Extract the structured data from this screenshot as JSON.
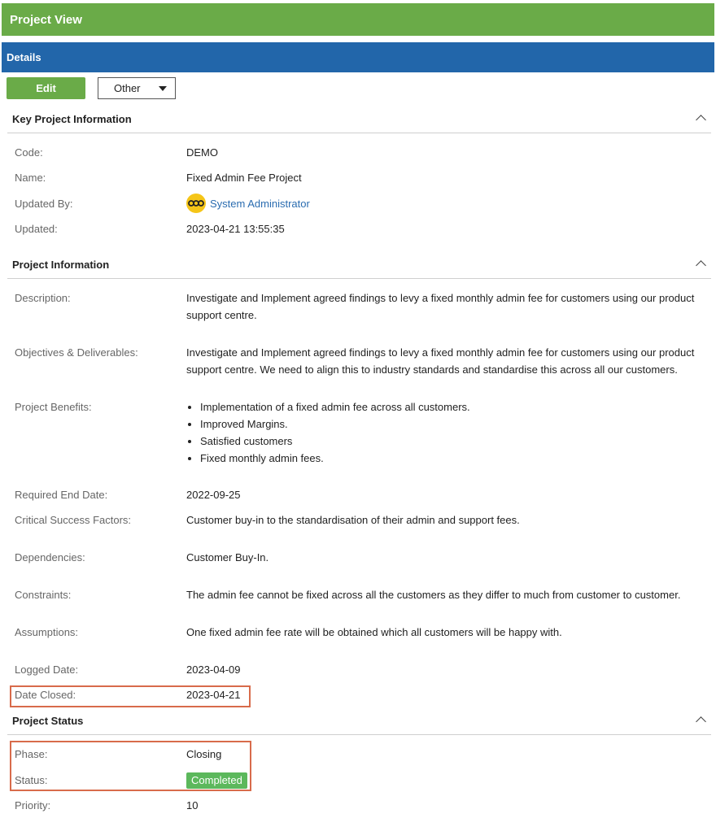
{
  "header": {
    "title": "Project View"
  },
  "details_bar": {
    "title": "Details"
  },
  "toolbar": {
    "edit_label": "Edit",
    "other_label": "Other"
  },
  "key_info": {
    "title": "Key Project Information",
    "code_label": "Code:",
    "code": "DEMO",
    "name_label": "Name:",
    "name": "Fixed Admin Fee Project",
    "updated_by_label": "Updated By:",
    "updated_by": "System Administrator",
    "updated_label": "Updated:",
    "updated": "2023-04-21 13:55:35"
  },
  "project_info": {
    "title": "Project Information",
    "description_label": "Description:",
    "description": "Investigate and Implement agreed findings to levy a fixed monthly admin fee for customers using our product support centre.",
    "objectives_label": "Objectives & Deliverables:",
    "objectives": "Investigate and Implement agreed findings to levy a fixed monthly admin fee for customers using our product support centre. We need to align this to industry standards and standardise this across all our customers.",
    "benefits_label": "Project Benefits:",
    "benefits": [
      "Implementation of a fixed admin fee across all customers.",
      "Improved Margins.",
      "Satisfied customers",
      "Fixed monthly admin fees."
    ],
    "required_end_label": "Required End Date:",
    "required_end": "2022-09-25",
    "csf_label": "Critical Success Factors:",
    "csf": "Customer buy-in to the standardisation of their admin and support fees.",
    "dependencies_label": "Dependencies:",
    "dependencies": "Customer Buy-In.",
    "constraints_label": "Constraints:",
    "constraints": "The admin fee cannot be fixed across all the customers as they differ to much from customer to customer.",
    "assumptions_label": "Assumptions:",
    "assumptions": "One fixed admin fee rate will be obtained which all customers will be happy with.",
    "logged_label": "Logged Date:",
    "logged": "2023-04-09",
    "closed_label": "Date Closed:",
    "closed": "2023-04-21"
  },
  "project_status": {
    "title": "Project Status",
    "phase_label": "Phase:",
    "phase": "Closing",
    "status_label": "Status:",
    "status": "Completed",
    "priority_label": "Priority:",
    "priority": "10"
  },
  "colors": {
    "green": "#6aab48",
    "blue": "#2266aa",
    "badge": "#5cb85c",
    "highlight": "#d86b4b",
    "link": "#2a6cb0"
  }
}
